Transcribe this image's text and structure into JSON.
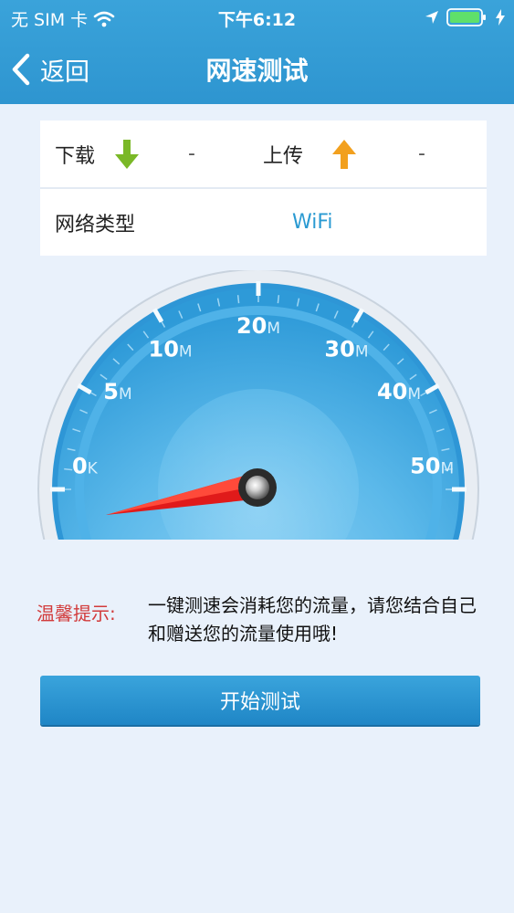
{
  "status_bar": {
    "carrier": "无 SIM 卡",
    "time": "下午6:12"
  },
  "nav": {
    "back_label": "返回",
    "title": "网速测试"
  },
  "info": {
    "download_label": "下载",
    "download_value": "-",
    "upload_label": "上传",
    "upload_value": "-",
    "network_type_label": "网络类型",
    "network_type_value": "WiFi"
  },
  "gauge": {
    "labels": [
      {
        "value": "0",
        "unit": "K"
      },
      {
        "value": "5",
        "unit": "M"
      },
      {
        "value": "10",
        "unit": "M"
      },
      {
        "value": "20",
        "unit": "M"
      },
      {
        "value": "30",
        "unit": "M"
      },
      {
        "value": "40",
        "unit": "M"
      },
      {
        "value": "50",
        "unit": "M"
      }
    ],
    "colors": {
      "dial": "#3aa6e0",
      "needle": "#e01a1a"
    }
  },
  "tip": {
    "label": "温馨提示:",
    "text": "一键测速会消耗您的流量，请您结合自己和赠送您的流量使用哦!"
  },
  "start_button": {
    "label": "开始测试"
  },
  "colors": {
    "header": "#3aa3da",
    "background": "#e9f1fb",
    "accent": "#2a9ad2",
    "tip_label": "#d23b3b"
  }
}
